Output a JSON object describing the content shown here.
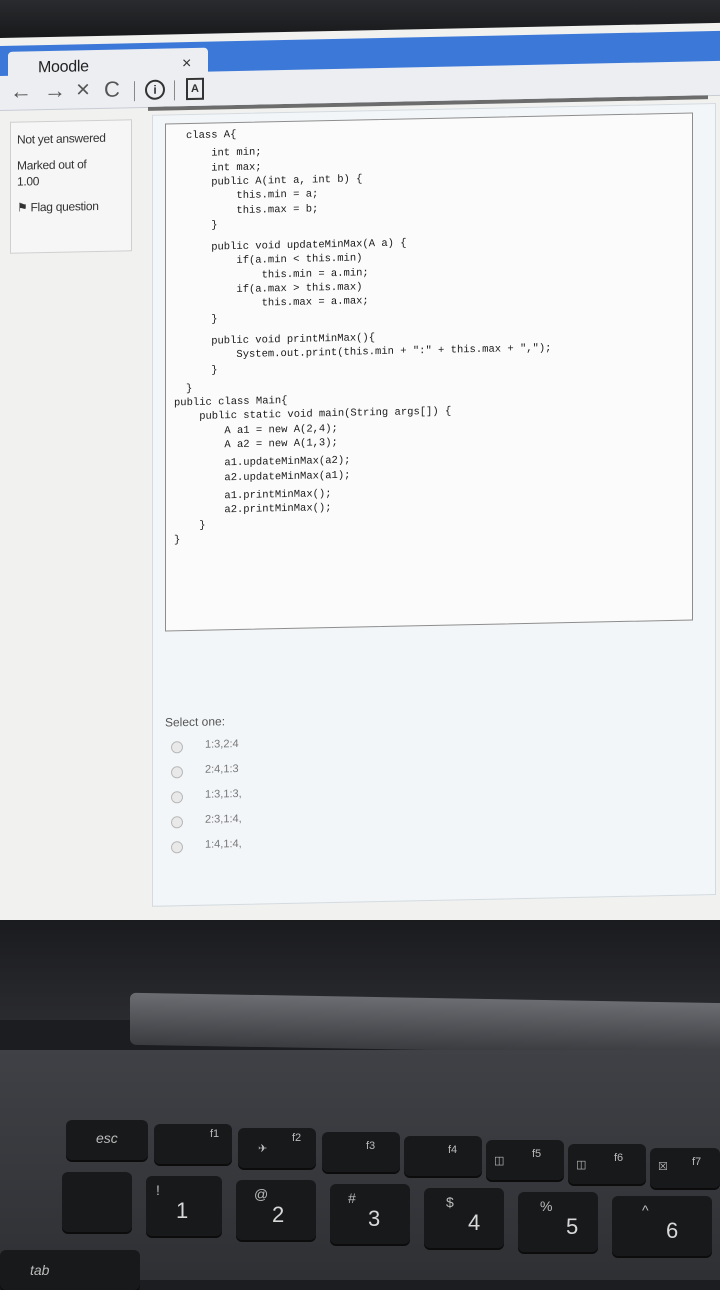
{
  "browser": {
    "tab_title": "Moodle",
    "close_glyph": "×",
    "back_glyph": "←",
    "forward_glyph": "→",
    "stop_glyph": "×",
    "reload_glyph": "C",
    "info_glyph": "i",
    "doc_glyph": "A"
  },
  "question_info": {
    "state": "Not yet answered",
    "marked_label": "Marked out of",
    "marked_value": "1.00",
    "flag_label": "Flag question"
  },
  "code": [
    "class A{",
    "    int min;",
    "    int max;",
    "    public A(int a, int b) {",
    "        this.min = a;",
    "        this.max = b;",
    "    }",
    "    public void updateMinMax(A a) {",
    "        if(a.min < this.min)",
    "            this.min = a.min;",
    "        if(a.max > this.max)",
    "            this.max = a.max;",
    "    }",
    "    public void printMinMax(){",
    "        System.out.print(this.min + \":\" + this.max + \",\");",
    "    }",
    "}",
    "public class Main{",
    "    public static void main(String args[]) {",
    "        A a1 = new A(2,4);",
    "        A a2 = new A(1,3);",
    "        a1.updateMinMax(a2);",
    "        a2.updateMinMax(a1);",
    "        a1.printMinMax();",
    "        a2.printMinMax();",
    "    }",
    "}"
  ],
  "answer": {
    "prompt": "Select one:",
    "options": [
      "1:3,2:4",
      "2:4,1:3",
      "1:3,1:3,",
      "2:3,1:4,",
      "1:4,1:4,"
    ]
  },
  "keyboard": {
    "esc": "esc",
    "f1": "f1",
    "f2": "f2",
    "f3": "f3",
    "f4": "f4",
    "f5": "f5",
    "f6": "f6",
    "f7": "f7",
    "k1": "1",
    "k1_shift": "!",
    "k2": "2",
    "k2_shift": "@",
    "k3": "3",
    "k3_shift": "#",
    "k4": "4",
    "k4_shift": "$",
    "k5": "5",
    "k5_shift": "%",
    "k6": "6",
    "k6_shift": "^",
    "tab": "tab"
  }
}
